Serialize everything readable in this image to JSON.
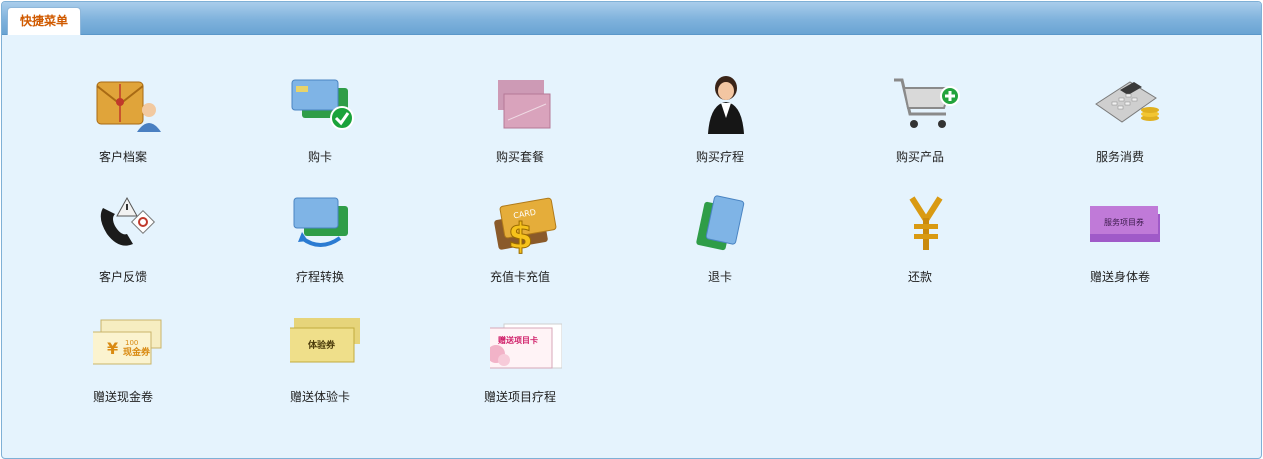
{
  "tab": {
    "label": "快捷菜单"
  },
  "menu": [
    {
      "label": "客户档案",
      "icon": "customer-file-icon"
    },
    {
      "label": "购卡",
      "icon": "buy-card-icon"
    },
    {
      "label": "购买套餐",
      "icon": "package-icon"
    },
    {
      "label": "购买疗程",
      "icon": "receptionist-icon"
    },
    {
      "label": "购买产品",
      "icon": "shopping-cart-icon"
    },
    {
      "label": "服务消费",
      "icon": "calculator-icon"
    },
    {
      "label": "客户反馈",
      "icon": "phone-feedback-icon"
    },
    {
      "label": "疗程转换",
      "icon": "card-transfer-icon"
    },
    {
      "label": "充值卡充值",
      "icon": "card-recharge-icon"
    },
    {
      "label": "退卡",
      "icon": "return-card-icon"
    },
    {
      "label": "还款",
      "icon": "yuan-icon"
    },
    {
      "label": "赠送身体卷",
      "icon": "purple-voucher-icon"
    },
    {
      "label": "赠送现金卷",
      "icon": "cash-voucher-icon"
    },
    {
      "label": "赠送体验卡",
      "icon": "trial-card-icon"
    },
    {
      "label": "赠送项目疗程",
      "icon": "project-card-icon"
    }
  ],
  "icon_text": {
    "card": "CARD",
    "cash_amount": "100",
    "cash_voucher": "现金券",
    "trial": "体验券",
    "project": "赠送项目卡",
    "body": "服务项目券"
  }
}
